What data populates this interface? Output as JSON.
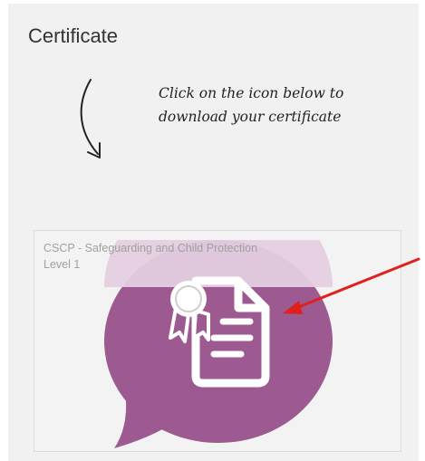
{
  "heading": "Certificate",
  "instruction": {
    "line1": "Click on the icon below to",
    "line2": "download your certificate"
  },
  "certificate_card": {
    "title_line1": "CSCP - Safeguarding and Child Protection",
    "title_line2": "Level 1",
    "icon": "certificate-download-icon"
  },
  "colors": {
    "panel_bg": "#f1f1f1",
    "bubble": "#9d5a91",
    "bubble_light": "#e4cfe0",
    "annotation_arrow": "#e0201c"
  }
}
